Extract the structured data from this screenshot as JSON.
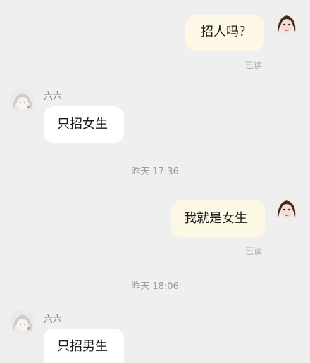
{
  "conversation": {
    "messages": [
      {
        "side": "right",
        "text": "招人吗？",
        "status": "已读"
      },
      {
        "side": "left",
        "sender": "六六",
        "text": "只招女生"
      },
      {
        "side": "right",
        "text": "我就是女生",
        "status": "已读"
      },
      {
        "side": "left",
        "sender": "六六",
        "text": "只招男生"
      }
    ],
    "timestamps": [
      "昨天 17:36",
      "昨天 18:06"
    ]
  },
  "icons": {
    "self_avatar": "woman-face-avatar-icon",
    "contact_avatar": "anime-girl-avatar-icon"
  },
  "colors": {
    "background": "#efefef",
    "own_bubble": "#fdf8e6",
    "contact_bubble": "#ffffff",
    "timestamp_text": "#9a9a9a"
  }
}
